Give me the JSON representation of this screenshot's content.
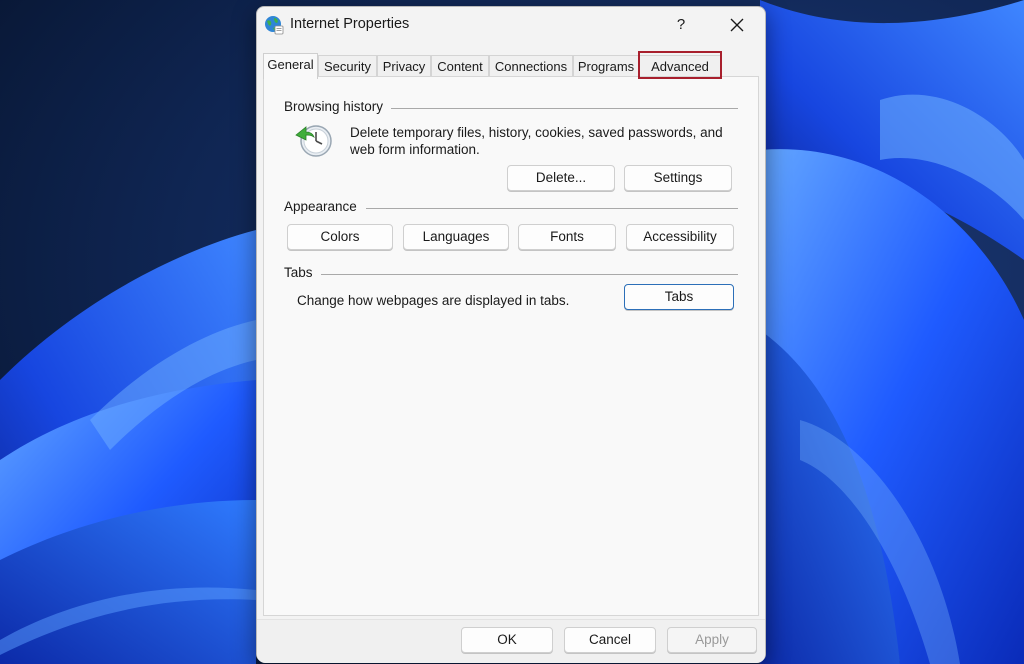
{
  "dialog": {
    "title": "Internet Properties",
    "help_label": "?",
    "icon": "globe-icon",
    "close_icon": "close-icon"
  },
  "tabs": [
    {
      "label": "General",
      "active": true
    },
    {
      "label": "Security"
    },
    {
      "label": "Privacy"
    },
    {
      "label": "Content"
    },
    {
      "label": "Connections"
    },
    {
      "label": "Programs"
    },
    {
      "label": "Advanced",
      "highlighted": true
    }
  ],
  "browsing_history": {
    "heading": "Browsing history",
    "icon": "history-clock-icon",
    "description": "Delete temporary files, history, cookies, saved passwords, and web form information.",
    "delete_label": "Delete...",
    "settings_label": "Settings"
  },
  "appearance": {
    "heading": "Appearance",
    "colors_label": "Colors",
    "languages_label": "Languages",
    "fonts_label": "Fonts",
    "accessibility_label": "Accessibility"
  },
  "tabs_section": {
    "heading": "Tabs",
    "description": "Change how webpages are displayed in tabs.",
    "tabs_label": "Tabs"
  },
  "footer": {
    "ok_label": "OK",
    "cancel_label": "Cancel",
    "apply_label": "Apply",
    "apply_enabled": false
  },
  "colors": {
    "highlight": "#a81f2d",
    "wallpaper_blue": "#1f5bff",
    "wallpaper_dark": "#0b1a3a"
  }
}
